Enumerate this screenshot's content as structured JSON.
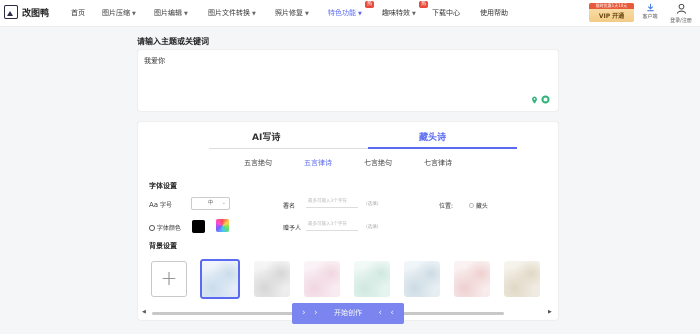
{
  "app": {
    "name": "改图鸭"
  },
  "nav": {
    "items": [
      {
        "label": "首页",
        "has_caret": false,
        "active": false,
        "badge": ""
      },
      {
        "label": "图片压缩",
        "has_caret": true,
        "active": false,
        "badge": ""
      },
      {
        "label": "图片编辑",
        "has_caret": true,
        "active": false,
        "badge": ""
      },
      {
        "label": "图片文件转换",
        "has_caret": true,
        "active": false,
        "badge": ""
      },
      {
        "label": "照片修复",
        "has_caret": true,
        "active": false,
        "badge": ""
      },
      {
        "label": "特色功能",
        "has_caret": true,
        "active": true,
        "badge": "热"
      },
      {
        "label": "趣味特效",
        "has_caret": true,
        "active": false,
        "badge": "热"
      },
      {
        "label": "下载中心",
        "has_caret": false,
        "active": false,
        "badge": ""
      },
      {
        "label": "使用帮助",
        "has_caret": false,
        "active": false,
        "badge": ""
      }
    ],
    "vip": {
      "promo": "限时优惠1天10元",
      "label": "VIP 开通"
    },
    "client": {
      "label": "客户端",
      "icon": "download-icon"
    },
    "user": {
      "label": "登录/注册",
      "icon": "avatar-icon"
    }
  },
  "input": {
    "title": "请输入主题或关键词",
    "value": "我爱你",
    "icons": [
      "location-icon",
      "refresh-icon"
    ]
  },
  "modes": {
    "tabs": [
      "AI写诗",
      "藏头诗"
    ],
    "active": 1
  },
  "poem_types": {
    "tabs": [
      "五言绝句",
      "五言律诗",
      "七言绝句",
      "七言律诗"
    ],
    "active": 1
  },
  "font_settings": {
    "title": "字体设置",
    "font_size": {
      "prefix": "Aa",
      "label": "字号",
      "value": "中"
    },
    "font_color": {
      "label": "字体颜色",
      "color": "#000000"
    },
    "signature": {
      "label": "署名",
      "placeholder": "最多可输入3个字符",
      "note": "(选填)"
    },
    "recipient": {
      "label": "赠予人",
      "placeholder": "最多可输入3个字符",
      "note": "(选填)"
    },
    "position": {
      "label": "位置:",
      "option": "藏头"
    }
  },
  "background": {
    "title": "背景设置",
    "add_label": "+",
    "tiles": [
      {
        "name": "bg-tile-1",
        "selected": true,
        "colors": [
          "#dfe9f6",
          "#c9dceb",
          "#f3f6fb"
        ]
      },
      {
        "name": "bg-tile-2",
        "selected": false,
        "colors": [
          "#ececec",
          "#d6d6d6",
          "#f6f6f6"
        ]
      },
      {
        "name": "bg-tile-3",
        "selected": false,
        "colors": [
          "#f7eaf0",
          "#f1d6e0",
          "#fbf4f7"
        ]
      },
      {
        "name": "bg-tile-4",
        "selected": false,
        "colors": [
          "#e3f3ee",
          "#cfe8df",
          "#f3faf8"
        ]
      },
      {
        "name": "bg-tile-5",
        "selected": false,
        "colors": [
          "#e4edf2",
          "#cddbe4",
          "#f1f6f9"
        ]
      },
      {
        "name": "bg-tile-6",
        "selected": false,
        "colors": [
          "#f7eaea",
          "#efd0d0",
          "#fbf3f3"
        ]
      },
      {
        "name": "bg-tile-7",
        "selected": false,
        "colors": [
          "#efeadf",
          "#e0d8c6",
          "#f7f4ee"
        ]
      }
    ]
  },
  "action": {
    "label": "开始创作"
  },
  "accent": "#5b6bf0"
}
